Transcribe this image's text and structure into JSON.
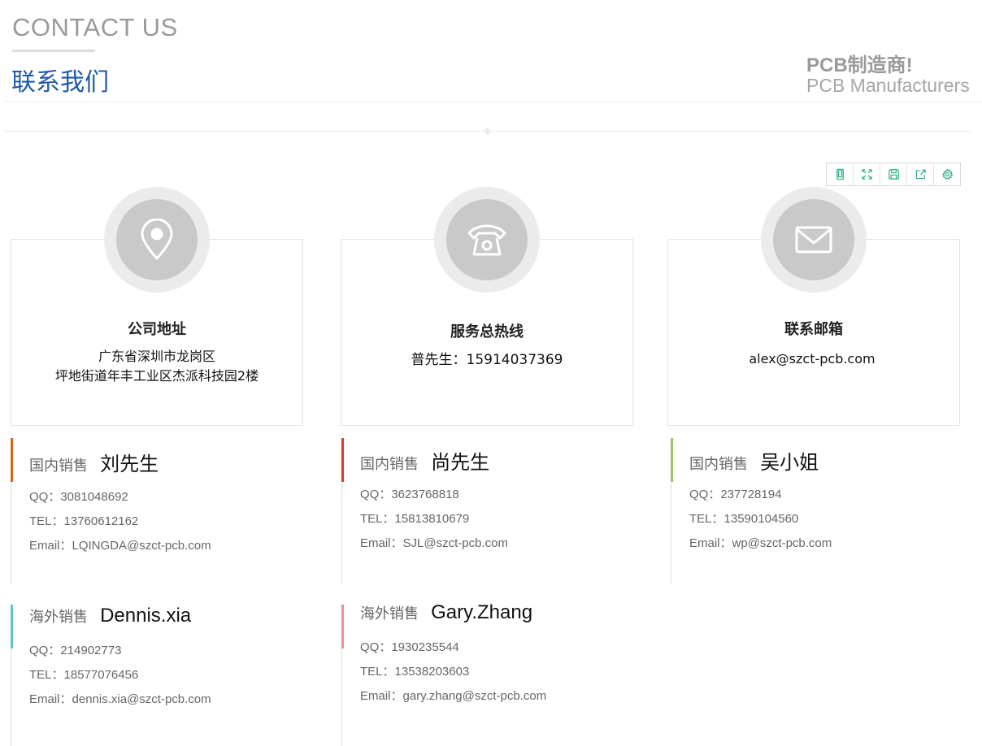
{
  "header": {
    "title_en": "CONTACT US",
    "title_cn": "联系我们",
    "slogan_cn": "PCB制造商!",
    "slogan_en": "PCB Manufacturers"
  },
  "toolbar": {
    "icons": [
      "mobile-icon",
      "fullscreen-icon",
      "save-icon",
      "share-icon",
      "settings-icon"
    ],
    "accent": "#2fae8c"
  },
  "cards": [
    {
      "icon": "location-pin-icon",
      "title": "公司地址",
      "lines": [
        "广东省深圳市龙岗区",
        "坪地街道年丰工业区杰派科技园2楼"
      ]
    },
    {
      "icon": "telephone-icon",
      "title": "服务总热线",
      "lines": [
        "普先生：15914037369"
      ]
    },
    {
      "icon": "envelope-icon",
      "title": "联系邮箱",
      "lines": [
        "alex@szct-pcb.com"
      ]
    }
  ],
  "sales": [
    {
      "role": "国内销售",
      "name": "刘先生",
      "qq": "QQ：3081048692",
      "tel": "TEL：13760612162",
      "email": "Email：LQINGDA@szct-pcb.com",
      "accent": "#d2691e"
    },
    {
      "role": "国内销售",
      "name": "尚先生",
      "qq": "QQ：3623768818",
      "tel": "TEL：15813810679",
      "email": "Email：SJL@szct-pcb.com",
      "accent": "#e0382e"
    },
    {
      "role": "国内销售",
      "name": "吴小姐",
      "qq": "QQ：237728194",
      "tel": "TEL：13590104560",
      "email": "Email：wp@szct-pcb.com",
      "accent": "#a3c26b"
    },
    {
      "role": "海外销售",
      "name": "Dennis.xia",
      "qq": "QQ：214902773",
      "tel": "TEL：18577076456",
      "email": "Email：dennis.xia@szct-pcb.com",
      "accent": "#5fc4c9"
    },
    {
      "role": "海外销售",
      "name": "Gary.Zhang",
      "qq": "QQ：1930235544",
      "tel": "TEL：13538203603",
      "email": "Email：gary.zhang@szct-pcb.com",
      "accent": "#f08d95"
    }
  ]
}
